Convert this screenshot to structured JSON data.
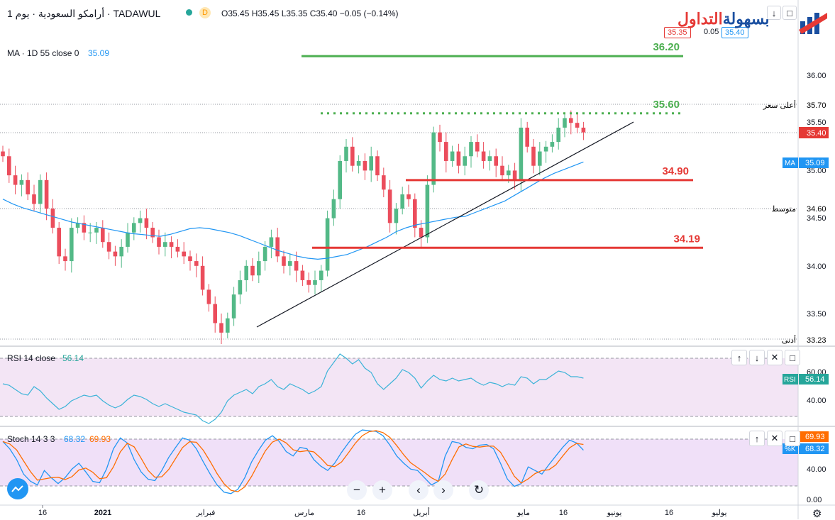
{
  "header": {
    "symbol": "أرامكو السعودية · يوم 1 · TADAWUL",
    "badge_d": "D",
    "ohlc": "O35.45 H35.45 L35.35 C35.40 −0.05 (−0.14%)",
    "ma_label": "MA · 1D 55 close 0",
    "ma_value": "35.09",
    "bid": "35.35",
    "spread": "0.05",
    "ask": "35.40"
  },
  "logo": {
    "text_red": "التداول",
    "text_blue": "بسهولة"
  },
  "colors": {
    "up": "#53b987",
    "down": "#eb4d5c",
    "ma": "#2196f3",
    "green_level": "#4caf50",
    "red_level": "#e53935",
    "rsi_bg": "#f3e5f5",
    "stoch_k": "#2196f3",
    "stoch_d": "#ff6d00"
  },
  "price_scale": {
    "ticks": [
      "36.00",
      "35.50",
      "35.00",
      "34.50",
      "34.00",
      "33.50"
    ],
    "high_label": "أعلى سعر",
    "high_value": "35.70",
    "last_label": "35.40",
    "ma_tag": "MA",
    "ma_value": "35.09",
    "mid_label": "متوسط",
    "mid_value": "34.60",
    "low_label": "أدنى",
    "low_value": "33.23"
  },
  "rsi": {
    "label": "RSI 14 close",
    "value": "56.14",
    "tag": "RSI",
    "ticks": [
      "60.00",
      "40.00"
    ]
  },
  "stoch": {
    "label": "Stoch 14 3 3",
    "k_value": "68.32",
    "d_value": "69.93",
    "k_tag": "%K",
    "ticks": [
      "40.00",
      "0.00"
    ]
  },
  "time_axis": [
    "16",
    "2021",
    "فبراير",
    "مارس",
    "16",
    "أبريل",
    "مايو",
    "16",
    "يونيو",
    "16",
    "يوليو"
  ],
  "controls": {
    "zoom_out": "−",
    "zoom_in": "+",
    "scroll_left": "‹",
    "scroll_right": "›",
    "reset": "↻"
  },
  "chart_data": {
    "type": "candlestick",
    "annotations": [
      {
        "text": "36.20",
        "value": 36.2,
        "style": "solid",
        "color": "green"
      },
      {
        "text": "35.60",
        "value": 35.6,
        "style": "dotted",
        "color": "green"
      },
      {
        "text": "34.90",
        "value": 34.9,
        "style": "solid",
        "color": "red"
      },
      {
        "text": "34.19",
        "value": 34.19,
        "style": "solid",
        "color": "red"
      }
    ],
    "ylim": [
      33.2,
      36.4
    ],
    "closes": [
      35.15,
      34.95,
      34.85,
      34.9,
      34.75,
      34.65,
      34.9,
      34.6,
      34.4,
      34.1,
      34.05,
      34.4,
      34.45,
      34.35,
      34.35,
      34.4,
      34.25,
      34.15,
      34.1,
      34.2,
      34.35,
      34.45,
      34.5,
      34.4,
      34.3,
      34.2,
      34.25,
      34.2,
      34.15,
      34.1,
      34.05,
      34.0,
      33.75,
      33.6,
      33.4,
      33.3,
      33.45,
      33.7,
      33.85,
      34.0,
      33.9,
      34.05,
      34.2,
      34.3,
      34.1,
      34.0,
      34.05,
      33.95,
      33.85,
      33.8,
      33.85,
      33.95,
      34.5,
      34.7,
      35.1,
      35.25,
      35.05,
      35.1,
      35.0,
      35.15,
      34.95,
      34.8,
      34.45,
      34.6,
      34.75,
      34.7,
      34.4,
      34.3,
      34.85,
      35.4,
      35.3,
      35.1,
      35.2,
      35.05,
      35.15,
      35.3,
      35.2,
      35.1,
      35.15,
      35.05,
      34.95,
      35.0,
      34.9,
      35.45,
      35.25,
      35.05,
      35.2,
      35.25,
      35.3,
      35.45,
      35.55,
      35.5,
      35.45,
      35.4
    ],
    "ma55": [
      34.7,
      34.65,
      34.61,
      34.58,
      34.55,
      34.52,
      34.49,
      34.46,
      34.44,
      34.42,
      34.4,
      34.38,
      34.36,
      34.34,
      34.33,
      34.32,
      34.31,
      34.33,
      34.36,
      34.39,
      34.4,
      34.39,
      34.37,
      34.35,
      34.32,
      34.28,
      34.24,
      34.2,
      34.16,
      34.13,
      34.1,
      34.08,
      34.07,
      34.08,
      34.1,
      34.12,
      34.16,
      34.2,
      34.25,
      34.3,
      34.36,
      34.4,
      34.43,
      34.45,
      34.47,
      34.49,
      34.51,
      34.52,
      34.56,
      34.6,
      34.64,
      34.68,
      34.74,
      34.8,
      34.86,
      34.92,
      34.97,
      35.01,
      35.05,
      35.09
    ],
    "rsi": [
      52,
      51,
      48,
      45,
      44,
      50,
      47,
      42,
      38,
      34,
      36,
      40,
      42,
      44,
      43,
      44,
      40,
      37,
      35,
      37,
      41,
      44,
      43,
      41,
      38,
      36,
      38,
      36,
      34,
      32,
      31,
      30,
      26,
      24,
      27,
      32,
      40,
      44,
      46,
      48,
      45,
      50,
      52,
      55,
      50,
      48,
      52,
      50,
      48,
      45,
      47,
      50,
      61,
      67,
      73,
      70,
      66,
      69,
      63,
      60,
      52,
      48,
      52,
      56,
      62,
      60,
      56,
      49,
      54,
      58,
      55,
      54,
      56,
      54,
      55,
      56,
      53,
      51,
      53,
      52,
      50,
      52,
      51,
      57,
      56,
      52,
      55,
      55,
      58,
      61,
      60,
      57,
      57,
      56
    ],
    "stoch_k": [
      80,
      70,
      55,
      35,
      25,
      20,
      40,
      30,
      22,
      30,
      42,
      50,
      38,
      25,
      23,
      42,
      70,
      85,
      78,
      55,
      38,
      28,
      26,
      40,
      58,
      72,
      85,
      82,
      70,
      52,
      35,
      20,
      10,
      8,
      14,
      30,
      52,
      68,
      82,
      88,
      80,
      66,
      60,
      72,
      70,
      55,
      46,
      40,
      50,
      65,
      78,
      90,
      96,
      95,
      94,
      88,
      75,
      60,
      50,
      42,
      40,
      30,
      20,
      25,
      60,
      80,
      78,
      72,
      70,
      75,
      76,
      70,
      50,
      28,
      18,
      22,
      45,
      40,
      35,
      48,
      60,
      72,
      82,
      78,
      68
    ]
  }
}
